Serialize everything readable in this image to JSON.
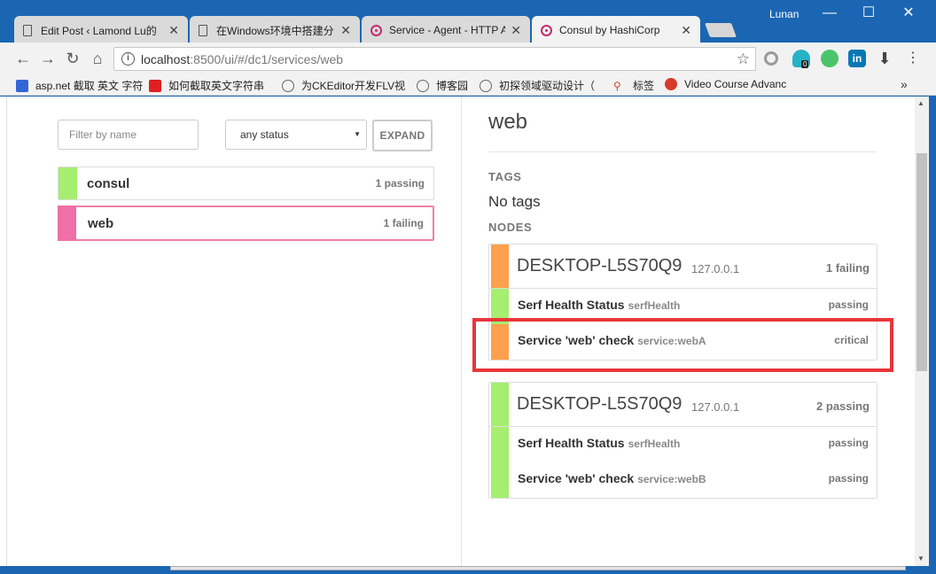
{
  "browser": {
    "tabs": [
      {
        "title": "Edit Post ‹ Lamond Lu的",
        "icon": "document-icon"
      },
      {
        "title": "在Windows环境中搭建分",
        "icon": "document-icon"
      },
      {
        "title": "Service - Agent - HTTP A",
        "icon": "consul-icon"
      },
      {
        "title": "Consul by HashiCorp",
        "icon": "consul-icon"
      }
    ],
    "user_name": "Lunan",
    "window_controls": {
      "minimize": "—",
      "maximize": "☐",
      "close": "✕"
    },
    "url_host": "localhost",
    "url_rest": ":8500/ui/#/dc1/services/web",
    "extension_badge": "0",
    "bookmarks": [
      "asp.net 截取 英文 字符",
      "如何截取英文字符串",
      "为CKEditor开发FLV视",
      "博客园",
      "初探领域驱动设计（",
      "标签",
      "Video Course Advanc"
    ],
    "bookmarks_more": "»"
  },
  "consul": {
    "filter_placeholder": "Filter by name",
    "status_filter": "any status",
    "expand_label": "EXPAND",
    "services": [
      {
        "name": "consul",
        "status": "1 passing",
        "health": "passing"
      },
      {
        "name": "web",
        "status": "1 failing",
        "health": "failing"
      }
    ],
    "detail": {
      "title": "web",
      "tags_label": "TAGS",
      "tags_value": "No tags",
      "nodes_label": "NODES",
      "nodes": [
        {
          "name": "DESKTOP-L5S70Q9",
          "ip": "127.0.0.1",
          "status": "1 failing",
          "checks": [
            {
              "name": "Serf Health Status",
              "id": "serfHealth",
              "status": "passing"
            },
            {
              "name": "Service 'web' check",
              "id": "service:webA",
              "status": "critical"
            }
          ]
        },
        {
          "name": "DESKTOP-L5S70Q9",
          "ip": "127.0.0.1",
          "status": "2 passing",
          "checks": [
            {
              "name": "Serf Health Status",
              "id": "serfHealth",
              "status": "passing"
            },
            {
              "name": "Service 'web' check",
              "id": "service:webB",
              "status": "passing"
            }
          ]
        }
      ]
    }
  },
  "colors": {
    "passing": "#a6ee6f",
    "failing": "#ef6fa6",
    "warning": "#ffa04c",
    "highlight": "#e8363a",
    "chrome_frame": "#1b66b3"
  }
}
